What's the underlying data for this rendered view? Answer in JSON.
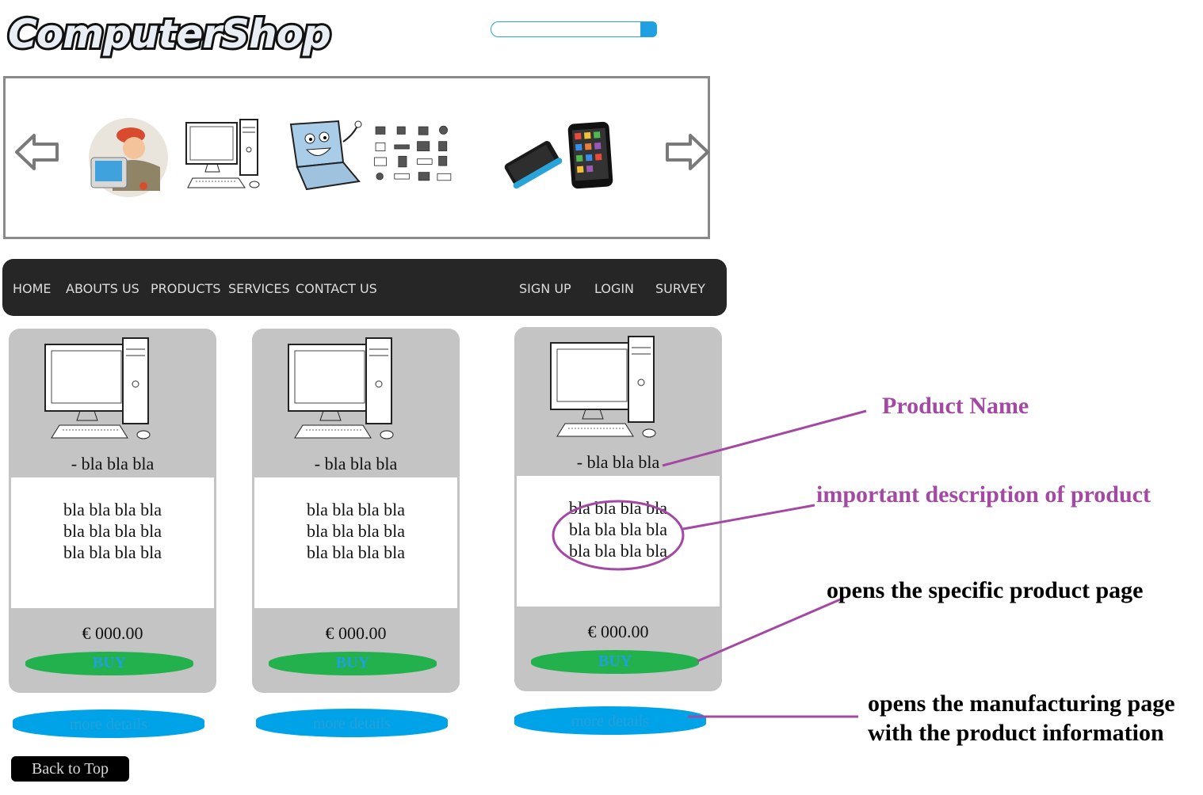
{
  "logo": {
    "text": "ComputerShop"
  },
  "search": {
    "placeholder": ""
  },
  "carousel": {
    "prev_icon": "arrow-left-icon",
    "next_icon": "arrow-right-icon",
    "images": [
      "technician",
      "desktop-computer",
      "laptop-mascot",
      "hardware-icons",
      "smartphone",
      "tablet"
    ]
  },
  "nav": {
    "left": [
      "HOME",
      "ABOUTS US",
      "PRODUCTS",
      "SERVICES",
      "CONTACT US"
    ],
    "right": [
      "SIGN UP",
      "LOGIN",
      "SURVEY"
    ]
  },
  "products": [
    {
      "name": "-  bla bla bla",
      "desc": [
        "bla bla bla bla",
        "bla bla bla bla",
        "bla bla bla bla"
      ],
      "price": "€ 000.00",
      "buy": "BUY",
      "details": "more details"
    },
    {
      "name": "-  bla bla bla",
      "desc": [
        "bla bla bla bla",
        "bla bla bla bla",
        "bla bla bla bla"
      ],
      "price": "€ 000.00",
      "buy": "BUY",
      "details": "more details"
    },
    {
      "name": "-  bla bla bla",
      "desc": [
        "bla bla bla bla",
        "bla bla bla bla",
        "bla bla bla bla"
      ],
      "price": "€ 000.00",
      "buy": "BUY",
      "details": "more details"
    }
  ],
  "back_to_top": "Back to Top",
  "annotations": {
    "product_name": "Product Name",
    "description": "important description of product",
    "buy": "opens the specific product page",
    "details_line1": "opens the manufacturing page",
    "details_line2": "with the product information"
  },
  "colors": {
    "nav_bg": "#262626",
    "card_bg": "#c4c4c4",
    "buy_green": "#22b14c",
    "details_blue": "#00a2e8",
    "annotation_purple": "#a349a4"
  }
}
